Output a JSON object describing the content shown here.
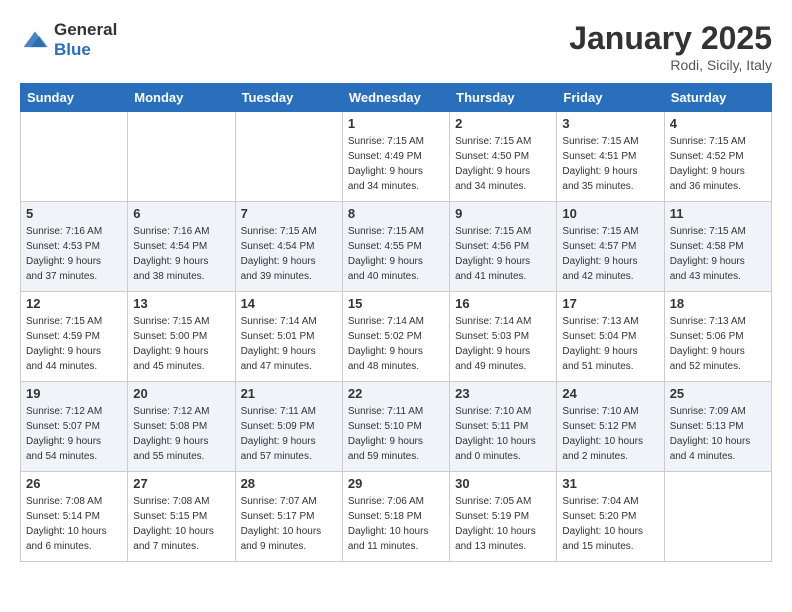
{
  "header": {
    "logo_general": "General",
    "logo_blue": "Blue",
    "month": "January 2025",
    "location": "Rodi, Sicily, Italy"
  },
  "weekdays": [
    "Sunday",
    "Monday",
    "Tuesday",
    "Wednesday",
    "Thursday",
    "Friday",
    "Saturday"
  ],
  "weeks": [
    [
      {
        "day": "",
        "info": ""
      },
      {
        "day": "",
        "info": ""
      },
      {
        "day": "",
        "info": ""
      },
      {
        "day": "1",
        "info": "Sunrise: 7:15 AM\nSunset: 4:49 PM\nDaylight: 9 hours\nand 34 minutes."
      },
      {
        "day": "2",
        "info": "Sunrise: 7:15 AM\nSunset: 4:50 PM\nDaylight: 9 hours\nand 34 minutes."
      },
      {
        "day": "3",
        "info": "Sunrise: 7:15 AM\nSunset: 4:51 PM\nDaylight: 9 hours\nand 35 minutes."
      },
      {
        "day": "4",
        "info": "Sunrise: 7:15 AM\nSunset: 4:52 PM\nDaylight: 9 hours\nand 36 minutes."
      }
    ],
    [
      {
        "day": "5",
        "info": "Sunrise: 7:16 AM\nSunset: 4:53 PM\nDaylight: 9 hours\nand 37 minutes."
      },
      {
        "day": "6",
        "info": "Sunrise: 7:16 AM\nSunset: 4:54 PM\nDaylight: 9 hours\nand 38 minutes."
      },
      {
        "day": "7",
        "info": "Sunrise: 7:15 AM\nSunset: 4:54 PM\nDaylight: 9 hours\nand 39 minutes."
      },
      {
        "day": "8",
        "info": "Sunrise: 7:15 AM\nSunset: 4:55 PM\nDaylight: 9 hours\nand 40 minutes."
      },
      {
        "day": "9",
        "info": "Sunrise: 7:15 AM\nSunset: 4:56 PM\nDaylight: 9 hours\nand 41 minutes."
      },
      {
        "day": "10",
        "info": "Sunrise: 7:15 AM\nSunset: 4:57 PM\nDaylight: 9 hours\nand 42 minutes."
      },
      {
        "day": "11",
        "info": "Sunrise: 7:15 AM\nSunset: 4:58 PM\nDaylight: 9 hours\nand 43 minutes."
      }
    ],
    [
      {
        "day": "12",
        "info": "Sunrise: 7:15 AM\nSunset: 4:59 PM\nDaylight: 9 hours\nand 44 minutes."
      },
      {
        "day": "13",
        "info": "Sunrise: 7:15 AM\nSunset: 5:00 PM\nDaylight: 9 hours\nand 45 minutes."
      },
      {
        "day": "14",
        "info": "Sunrise: 7:14 AM\nSunset: 5:01 PM\nDaylight: 9 hours\nand 47 minutes."
      },
      {
        "day": "15",
        "info": "Sunrise: 7:14 AM\nSunset: 5:02 PM\nDaylight: 9 hours\nand 48 minutes."
      },
      {
        "day": "16",
        "info": "Sunrise: 7:14 AM\nSunset: 5:03 PM\nDaylight: 9 hours\nand 49 minutes."
      },
      {
        "day": "17",
        "info": "Sunrise: 7:13 AM\nSunset: 5:04 PM\nDaylight: 9 hours\nand 51 minutes."
      },
      {
        "day": "18",
        "info": "Sunrise: 7:13 AM\nSunset: 5:06 PM\nDaylight: 9 hours\nand 52 minutes."
      }
    ],
    [
      {
        "day": "19",
        "info": "Sunrise: 7:12 AM\nSunset: 5:07 PM\nDaylight: 9 hours\nand 54 minutes."
      },
      {
        "day": "20",
        "info": "Sunrise: 7:12 AM\nSunset: 5:08 PM\nDaylight: 9 hours\nand 55 minutes."
      },
      {
        "day": "21",
        "info": "Sunrise: 7:11 AM\nSunset: 5:09 PM\nDaylight: 9 hours\nand 57 minutes."
      },
      {
        "day": "22",
        "info": "Sunrise: 7:11 AM\nSunset: 5:10 PM\nDaylight: 9 hours\nand 59 minutes."
      },
      {
        "day": "23",
        "info": "Sunrise: 7:10 AM\nSunset: 5:11 PM\nDaylight: 10 hours\nand 0 minutes."
      },
      {
        "day": "24",
        "info": "Sunrise: 7:10 AM\nSunset: 5:12 PM\nDaylight: 10 hours\nand 2 minutes."
      },
      {
        "day": "25",
        "info": "Sunrise: 7:09 AM\nSunset: 5:13 PM\nDaylight: 10 hours\nand 4 minutes."
      }
    ],
    [
      {
        "day": "26",
        "info": "Sunrise: 7:08 AM\nSunset: 5:14 PM\nDaylight: 10 hours\nand 6 minutes."
      },
      {
        "day": "27",
        "info": "Sunrise: 7:08 AM\nSunset: 5:15 PM\nDaylight: 10 hours\nand 7 minutes."
      },
      {
        "day": "28",
        "info": "Sunrise: 7:07 AM\nSunset: 5:17 PM\nDaylight: 10 hours\nand 9 minutes."
      },
      {
        "day": "29",
        "info": "Sunrise: 7:06 AM\nSunset: 5:18 PM\nDaylight: 10 hours\nand 11 minutes."
      },
      {
        "day": "30",
        "info": "Sunrise: 7:05 AM\nSunset: 5:19 PM\nDaylight: 10 hours\nand 13 minutes."
      },
      {
        "day": "31",
        "info": "Sunrise: 7:04 AM\nSunset: 5:20 PM\nDaylight: 10 hours\nand 15 minutes."
      },
      {
        "day": "",
        "info": ""
      }
    ]
  ]
}
